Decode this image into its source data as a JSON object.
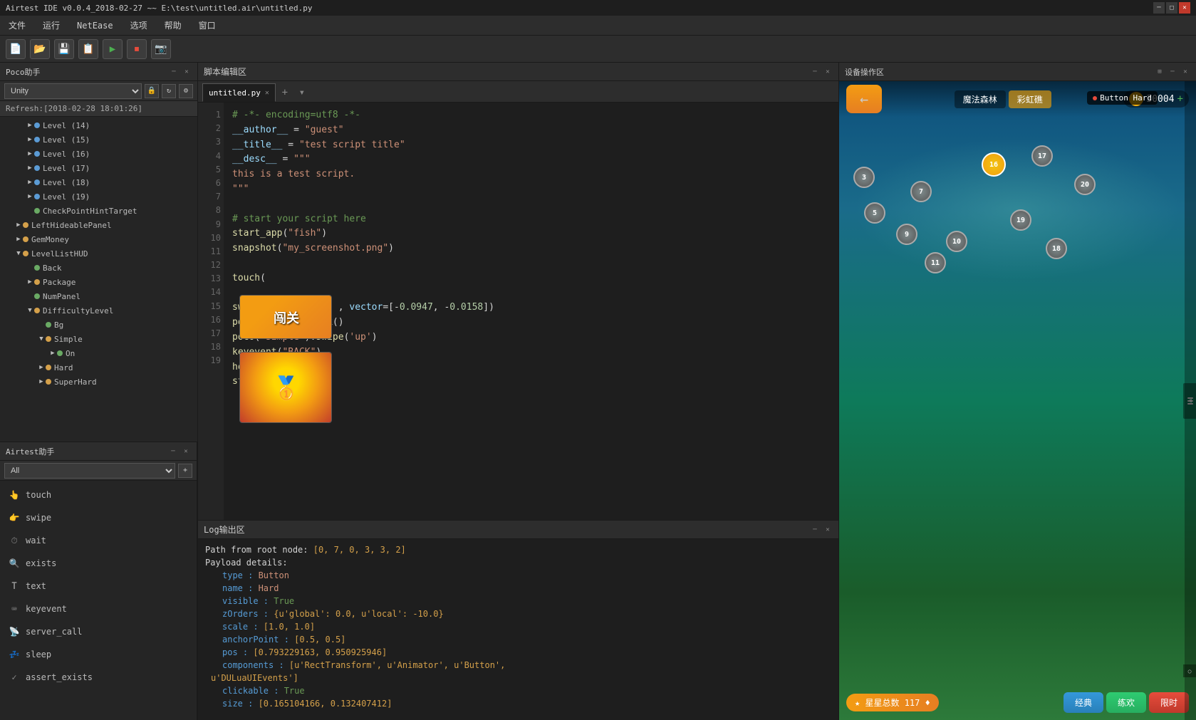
{
  "titlebar": {
    "title": "Airtest IDE v0.0.4_2018-02-27 ~~ E:\\test\\untitled.air\\untitled.py",
    "controls": [
      "minimize",
      "maximize",
      "close"
    ]
  },
  "menubar": {
    "items": [
      "文件",
      "运行",
      "NetEase",
      "选项",
      "帮助",
      "窗口"
    ]
  },
  "toolbar": {
    "buttons": [
      "new",
      "open",
      "save",
      "save-as",
      "run",
      "stop",
      "screenshot"
    ]
  },
  "poco_panel": {
    "title": "Poco助手",
    "selector_value": "Unity",
    "refresh_label": "Refresh:[2018-02-28 18:01:26]",
    "tree_items": [
      {
        "level": 3,
        "has_arrow": true,
        "type": "circle_blue",
        "label": "Level (14)"
      },
      {
        "level": 3,
        "has_arrow": true,
        "type": "circle_blue",
        "label": "Level (15)"
      },
      {
        "level": 3,
        "has_arrow": true,
        "type": "circle_blue",
        "label": "Level (16)"
      },
      {
        "level": 3,
        "has_arrow": true,
        "type": "circle_blue",
        "label": "Level (17)"
      },
      {
        "level": 3,
        "has_arrow": true,
        "type": "circle_blue",
        "label": "Level (18)"
      },
      {
        "level": 3,
        "has_arrow": true,
        "type": "circle_blue",
        "label": "Level (19)"
      },
      {
        "level": 3,
        "has_arrow": false,
        "type": "circle_green",
        "label": "CheckPointHintTarget"
      },
      {
        "level": 2,
        "has_arrow": true,
        "type": "circle_orange",
        "label": "LeftHideablePanel"
      },
      {
        "level": 2,
        "has_arrow": true,
        "type": "circle_orange",
        "label": "GemMoney"
      },
      {
        "level": 2,
        "has_arrow": true,
        "type": "circle_orange",
        "label": "LevelListHUD"
      },
      {
        "level": 3,
        "has_arrow": false,
        "type": "circle_green",
        "label": "Back"
      },
      {
        "level": 3,
        "has_arrow": true,
        "type": "circle_orange",
        "label": "Package"
      },
      {
        "level": 3,
        "has_arrow": false,
        "type": "circle_green",
        "label": "NumPanel"
      },
      {
        "level": 3,
        "has_arrow": true,
        "type": "circle_orange",
        "label": "DifficultyLevel"
      },
      {
        "level": 4,
        "has_arrow": false,
        "type": "circle_green",
        "label": "Bg"
      },
      {
        "level": 4,
        "has_arrow": true,
        "type": "circle_orange",
        "label": "Simple"
      },
      {
        "level": 5,
        "has_arrow": false,
        "type": "circle_green",
        "label": "On"
      },
      {
        "level": 4,
        "has_arrow": true,
        "type": "circle_orange",
        "label": "Hard"
      },
      {
        "level": 4,
        "has_arrow": true,
        "type": "circle_orange",
        "label": "SuperHard"
      }
    ]
  },
  "script_editor": {
    "title": "脚本编辑区",
    "tab_name": "untitled.py",
    "code_lines": [
      "# -*- encoding=utf8 -*-",
      "__author__ = \"guest\"",
      "__title__ = \"test script title\"",
      "__desc__ = \"\"\"",
      "this is a test script.",
      "\"\"\"",
      "",
      "# start your script here",
      "start_app(\"fish\")",
      "snapshot(\"my_screenshot.png\")",
      "",
      "touch(",
      "",
      "swipe(              , vector=[-0.0947, -0.0158])",
      "poco(\"Hard\").click()",
      "poco(\"Simple\").swipe('up')",
      "keyevent(\"BACK\")",
      "home()",
      "stop_app(\"fish\")"
    ]
  },
  "log_panel": {
    "title": "Log输出区",
    "content": [
      {
        "type": "normal",
        "text": "Path from root node: [0, 7, 0, 3, 3, 2]"
      },
      {
        "type": "normal",
        "text": "Payload details:"
      },
      {
        "type": "key_val",
        "key": "    type : ",
        "val": "Button"
      },
      {
        "type": "key_val",
        "key": "    name : ",
        "val": "Hard"
      },
      {
        "type": "key_val",
        "key": "    visible : ",
        "val": "True"
      },
      {
        "type": "key_val",
        "key": "    zOrders : ",
        "val": "{u'global': 0.0, u'local': -10.0}"
      },
      {
        "type": "key_val",
        "key": "    scale : ",
        "val": "[1.0, 1.0]"
      },
      {
        "type": "key_val",
        "key": "    anchorPoint : ",
        "val": "[0.5, 0.5]"
      },
      {
        "type": "key_val",
        "key": "    pos : ",
        "val": "[0.793229163, 0.950925946]"
      },
      {
        "type": "key_val",
        "key": "    components : ",
        "val": "[u'RectTransform', u'Animator', u'Button', u'DULuaUIEvents']"
      },
      {
        "type": "key_val",
        "key": "    clickable : ",
        "val": "True"
      },
      {
        "type": "key_val",
        "key": "    size : ",
        "val": "[0.165104166, 0.132407412]"
      }
    ]
  },
  "device_panel": {
    "title": "设备操作区",
    "game": {
      "nav_btn": "←",
      "menu1": "魔法森林",
      "menu2": "彩虹礁",
      "coins": "30004",
      "stars_label": "★ 星星总数 117 ♦",
      "mode1": "经典",
      "mode2": "练欢",
      "mode3": "限时",
      "hard_tooltip": "Button  Hard",
      "levels": [
        3,
        5,
        7,
        9,
        10,
        11,
        16,
        17,
        18,
        19,
        20
      ]
    }
  },
  "airtest_panel": {
    "title": "Airtest助手",
    "filter_value": "All",
    "items": [
      {
        "icon": "👆",
        "label": "touch"
      },
      {
        "icon": "👉",
        "label": "swipe"
      },
      {
        "icon": "⏱",
        "label": "wait"
      },
      {
        "icon": "🔍",
        "label": "exists"
      },
      {
        "icon": "T",
        "label": "text"
      },
      {
        "icon": "⌨",
        "label": "keyevent"
      },
      {
        "icon": "📡",
        "label": "server_call"
      },
      {
        "icon": "💤",
        "label": "sleep"
      },
      {
        "icon": "✓",
        "label": "assert_exists"
      }
    ]
  },
  "colors": {
    "accent": "#264f78",
    "bg_dark": "#1e1e1e",
    "bg_medium": "#252525",
    "bg_panel": "#2d2d2d",
    "border": "#1a1a1a",
    "text_main": "#d4d4d4",
    "text_dim": "#888888",
    "keyword": "#569cd6",
    "string": "#ce9178",
    "comment": "#6a9955"
  }
}
